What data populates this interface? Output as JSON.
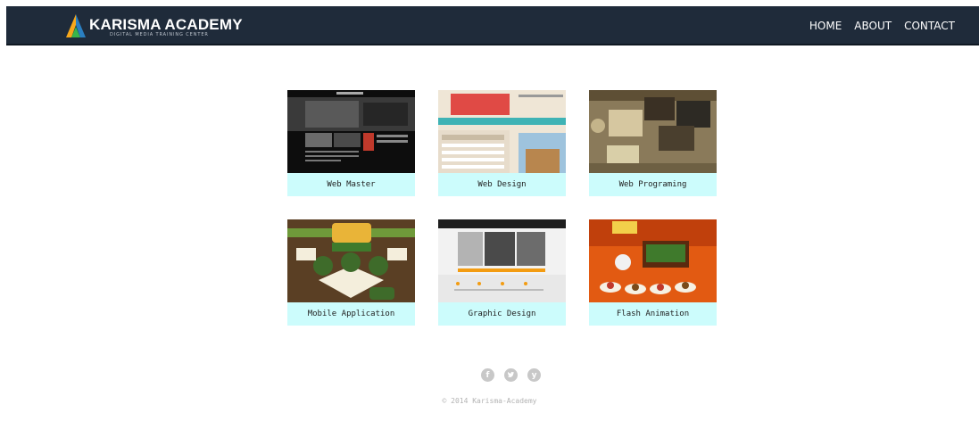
{
  "header": {
    "brand": "KARISMA ACADEMY",
    "tagline": "DIGITAL MEDIA TRAINING CENTER",
    "nav": [
      "HOME",
      "ABOUT",
      "CONTACT"
    ]
  },
  "courses": [
    {
      "label": "Web Master"
    },
    {
      "label": "Web Design"
    },
    {
      "label": "Web Programing"
    },
    {
      "label": "Mobile Application"
    },
    {
      "label": "Graphic Design"
    },
    {
      "label": "Flash Animation"
    }
  ],
  "footer": {
    "social": [
      "facebook-icon",
      "twitter-icon",
      "yahoo-icon"
    ],
    "copyright": "© 2014 Karisma-Academy"
  }
}
